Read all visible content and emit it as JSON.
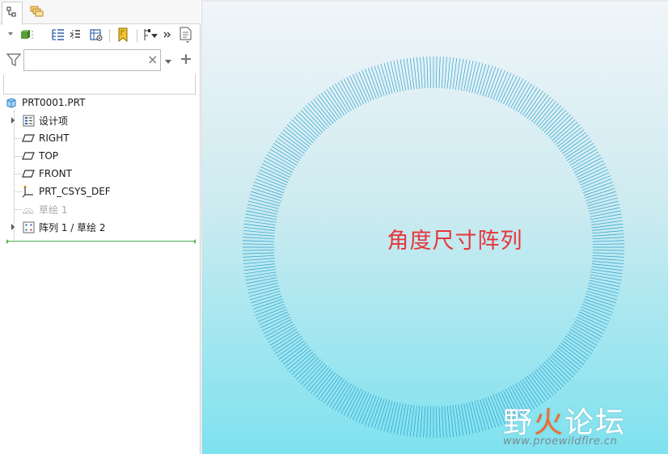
{
  "navigator": {
    "tabs": [
      {
        "icon": "model-tree-icon",
        "active": true
      },
      {
        "icon": "layer-tree-icon",
        "active": false
      }
    ],
    "toolbar_icons": [
      "settings-dropdown-icon",
      "show-icon",
      "tree-columns-icon",
      "expand-tree-icon",
      "tree-filter-icon",
      "bookmark-icon",
      "settings-filter-icon",
      "more-chevron-icon",
      "details-icon"
    ],
    "search": {
      "value": "",
      "clear_glyph": "×",
      "add_glyph": "+"
    },
    "tree": {
      "root": "PRT0001.PRT",
      "items": [
        {
          "label": "设计项",
          "icon": "design-items-icon",
          "expandable": true
        },
        {
          "label": "RIGHT",
          "icon": "datum-plane-icon",
          "expandable": false
        },
        {
          "label": "TOP",
          "icon": "datum-plane-icon",
          "expandable": false
        },
        {
          "label": "FRONT",
          "icon": "datum-plane-icon",
          "expandable": false
        },
        {
          "label": "PRT_CSYS_DEF",
          "icon": "coordinate-system-icon",
          "expandable": false
        },
        {
          "label": "草绘 1",
          "icon": "sketch-icon",
          "expandable": false,
          "suppressed": true
        },
        {
          "label": "阵列 1 / 草绘 2",
          "icon": "pattern-icon",
          "expandable": true
        }
      ]
    }
  },
  "viewport": {
    "caption": "角度尺寸阵列",
    "pattern_color": "#2a9fd0",
    "watermark": {
      "brand": "野火论坛",
      "url": "www.proewildfire.cn"
    }
  }
}
